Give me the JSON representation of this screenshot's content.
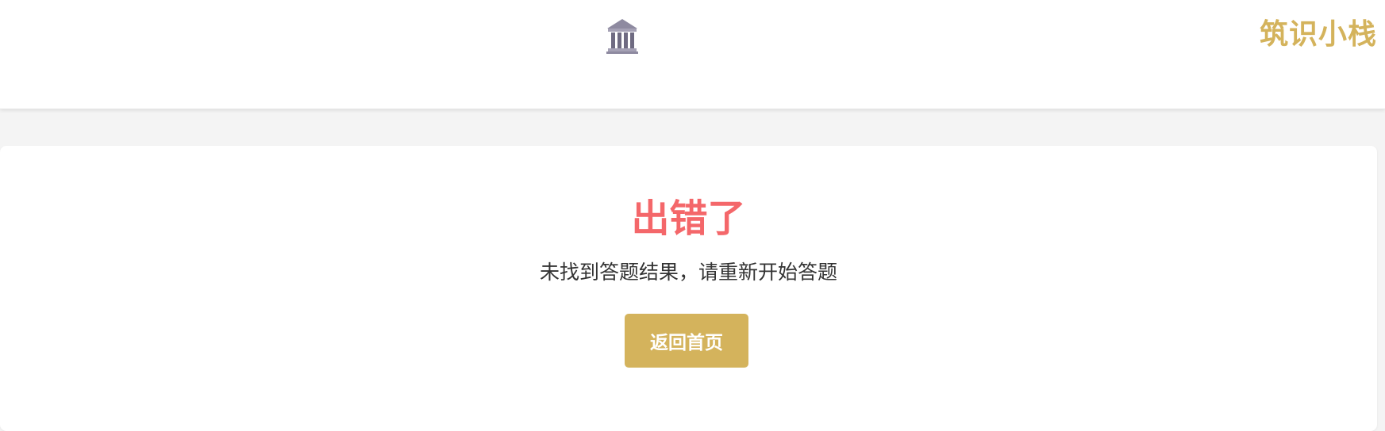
{
  "header": {
    "logo_icon": "classical-building-icon",
    "brand": "筑识小栈"
  },
  "error": {
    "title": "出错了",
    "message": "未找到答题结果，请重新开始答题",
    "home_button_label": "返回首页"
  },
  "colors": {
    "brand": "#d4b35c",
    "error": "#f4676a",
    "button": "#d4b35c",
    "page_bg": "#f4f4f4"
  }
}
